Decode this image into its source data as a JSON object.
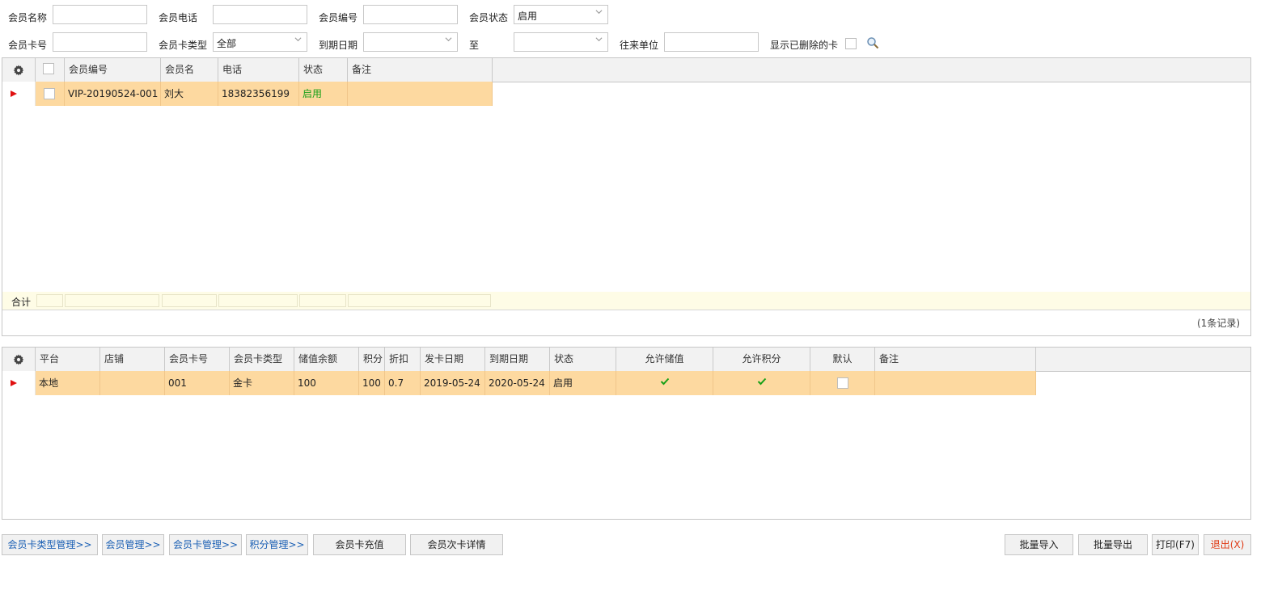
{
  "filters": {
    "member_name_label": "会员名称",
    "member_phone_label": "会员电话",
    "member_no_label": "会员编号",
    "member_status_label": "会员状态",
    "member_status_value": "启用",
    "card_no_label": "会员卡号",
    "card_type_label": "会员卡类型",
    "card_type_value": "全部",
    "expire_label": "到期日期",
    "to_label": "至",
    "partner_label": "往来单位",
    "show_deleted_label": "显示已删除的卡"
  },
  "members_grid": {
    "columns": [
      "会员编号",
      "会员名",
      "电话",
      "状态",
      "备注"
    ],
    "rows": [
      {
        "no": "VIP-20190524-001",
        "name": "刘大",
        "phone": "18382356199",
        "status": "启用",
        "remark": ""
      }
    ],
    "total_label": "合计",
    "record_count": "(1条记录)"
  },
  "cards_grid": {
    "columns": [
      "平台",
      "店铺",
      "会员卡号",
      "会员卡类型",
      "储值余额",
      "积分",
      "折扣",
      "发卡日期",
      "到期日期",
      "状态",
      "允许储值",
      "允许积分",
      "默认",
      "备注"
    ],
    "rows": [
      {
        "platform": "本地",
        "shop": "",
        "card_no": "001",
        "card_type": "金卡",
        "balance": "100",
        "points": "100",
        "discount": "0.7",
        "issue_date": "2019-05-24",
        "expire_date": "2020-05-24",
        "status": "启用",
        "allow_store": true,
        "allow_points": true,
        "default": false,
        "remark": ""
      }
    ]
  },
  "buttons": {
    "card_type_mgmt": "会员卡类型管理>>",
    "member_mgmt": "会员管理>>",
    "card_mgmt": "会员卡管理>>",
    "points_mgmt": "积分管理>>",
    "card_recharge": "会员卡充值",
    "times_card_detail": "会员次卡详情",
    "batch_import": "批量导入",
    "batch_export": "批量导出",
    "print": "打印(F7)",
    "exit": "退出(X)"
  },
  "colors": {
    "row_highlight": "#fdd9a0",
    "status_green": "#18a018",
    "link_blue": "#1a5fb4",
    "exit_red": "#e03b16",
    "indicator_red": "#e01010"
  }
}
